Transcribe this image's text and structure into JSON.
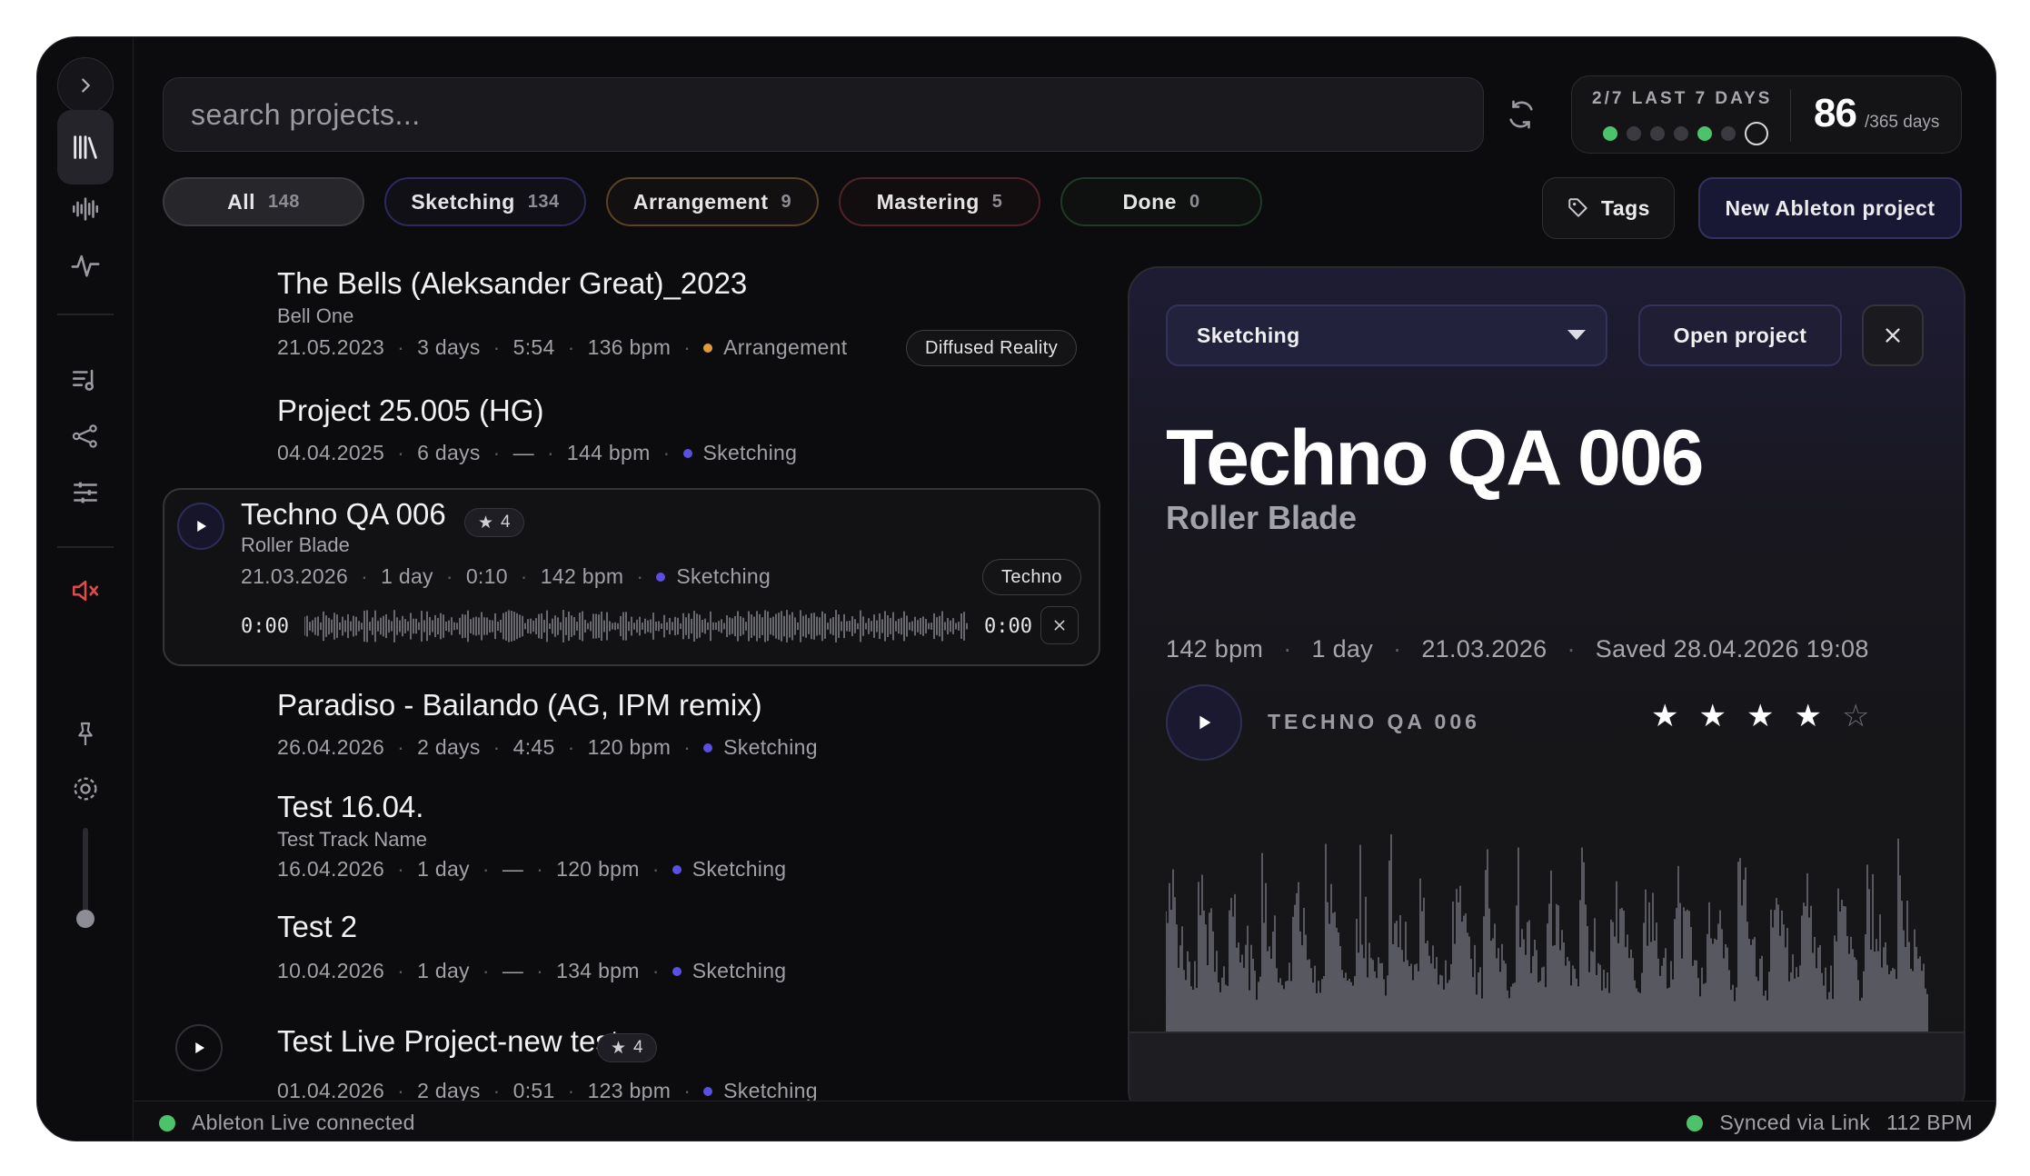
{
  "search": {
    "placeholder": "search projects..."
  },
  "streak": {
    "label": "2/7 LAST 7 DAYS",
    "days_big": "86",
    "days_small": "/365 days",
    "week": [
      true,
      false,
      false,
      false,
      true,
      false,
      "today"
    ]
  },
  "filters": [
    {
      "label": "All",
      "count": "148"
    },
    {
      "label": "Sketching",
      "count": "134"
    },
    {
      "label": "Arrangement",
      "count": "9"
    },
    {
      "label": "Mastering",
      "count": "5"
    },
    {
      "label": "Done",
      "count": "0"
    }
  ],
  "toolbar": {
    "tags_label": "Tags",
    "new_project_label": "New Ableton project"
  },
  "colors": {
    "sketching": "#5a4fe0",
    "arrangement": "#e09a3c",
    "mastering": "#e04a4a",
    "done": "#3aa35a",
    "accent_green": "#4cc36a",
    "mute_red": "#e04a4a"
  },
  "projects": [
    {
      "title": "The Bells (Aleksander Great)_2023",
      "artist": "Bell One",
      "date": "21.05.2023",
      "age": "3 days",
      "duration": "5:54",
      "bpm": "136 bpm",
      "status": "Arrangement",
      "tag": "Diffused Reality"
    },
    {
      "title": "Project 25.005 (HG)",
      "date": "04.04.2025",
      "age": "6 days",
      "duration": "—",
      "bpm": "144 bpm",
      "status": "Sketching"
    },
    {
      "title": "Techno QA 006",
      "artist": "Roller Blade",
      "rating": "4",
      "date": "21.03.2026",
      "age": "1 day",
      "duration": "0:10",
      "bpm": "142 bpm",
      "status": "Sketching",
      "tag": "Techno",
      "time_start": "0:00",
      "time_end": "0:00"
    },
    {
      "title": "Paradiso - Bailando (AG, IPM remix)",
      "date": "26.04.2026",
      "age": "2 days",
      "duration": "4:45",
      "bpm": "120 bpm",
      "status": "Sketching"
    },
    {
      "title": "Test 16.04.",
      "artist": "Test Track Name",
      "date": "16.04.2026",
      "age": "1 day",
      "duration": "—",
      "bpm": "120 bpm",
      "status": "Sketching"
    },
    {
      "title": "Test 2",
      "date": "10.04.2026",
      "age": "1 day",
      "duration": "—",
      "bpm": "134 bpm",
      "status": "Sketching"
    },
    {
      "title": "Test Live Project-new test",
      "rating": "4",
      "date": "01.04.2026",
      "age": "2 days",
      "duration": "0:51",
      "bpm": "123 bpm",
      "status": "Sketching"
    }
  ],
  "detail": {
    "status": "Sketching",
    "open_label": "Open project",
    "title": "Techno QA 006",
    "artist": "Roller Blade",
    "bpm": "142 bpm",
    "age": "1 day",
    "date": "21.03.2026",
    "saved": "Saved 28.04.2026 19:08",
    "player_label": "TECHNO QA 006",
    "rating": 4,
    "rating_max": 5
  },
  "status_bar": {
    "left": "Ableton Live connected",
    "sync": "Synced via Link",
    "bpm": "112 BPM"
  }
}
